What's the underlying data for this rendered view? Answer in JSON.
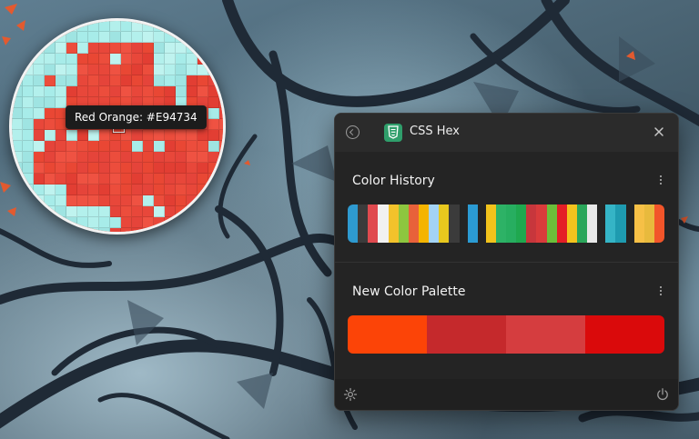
{
  "magnifier": {
    "tooltip": "Red Orange: #E94734",
    "sampled_color": "#E94734"
  },
  "panel": {
    "title": "CSS Hex",
    "app_icon": "css3-icon",
    "icons": {
      "back": "back-circle-icon",
      "close": "close-icon",
      "more": "more-vertical-icon",
      "settings": "gear-icon",
      "power": "power-icon"
    },
    "color_history": {
      "title": "Color History",
      "swatches": [
        "#2e9ad0",
        "#3b3b3b",
        "#e04a4f",
        "#f1f1f1",
        "#f3c22b",
        "#8dc63f",
        "#e8613a",
        "#f4b400",
        "#a3d3f5",
        "#e8c81e",
        "#3b3b3b",
        "gap",
        "#2b9bd3",
        "gap",
        "#f2c31c",
        "#2db266",
        "#27ae60",
        "#1fa84f",
        "#c7363c",
        "#d93b3b",
        "#6bbf3a",
        "#e41e26",
        "#f3c31d",
        "#2aa65a",
        "#e9e9e9",
        "gap",
        "#35b4c6",
        "#1e9bb0",
        "gap",
        "#f6c046",
        "#e8ba3d",
        "#f2552a"
      ]
    },
    "new_palette": {
      "title": "New Color Palette",
      "swatches": [
        "#fc4407",
        "#c5292c",
        "#d53d3f",
        "#da0a0b"
      ]
    }
  }
}
